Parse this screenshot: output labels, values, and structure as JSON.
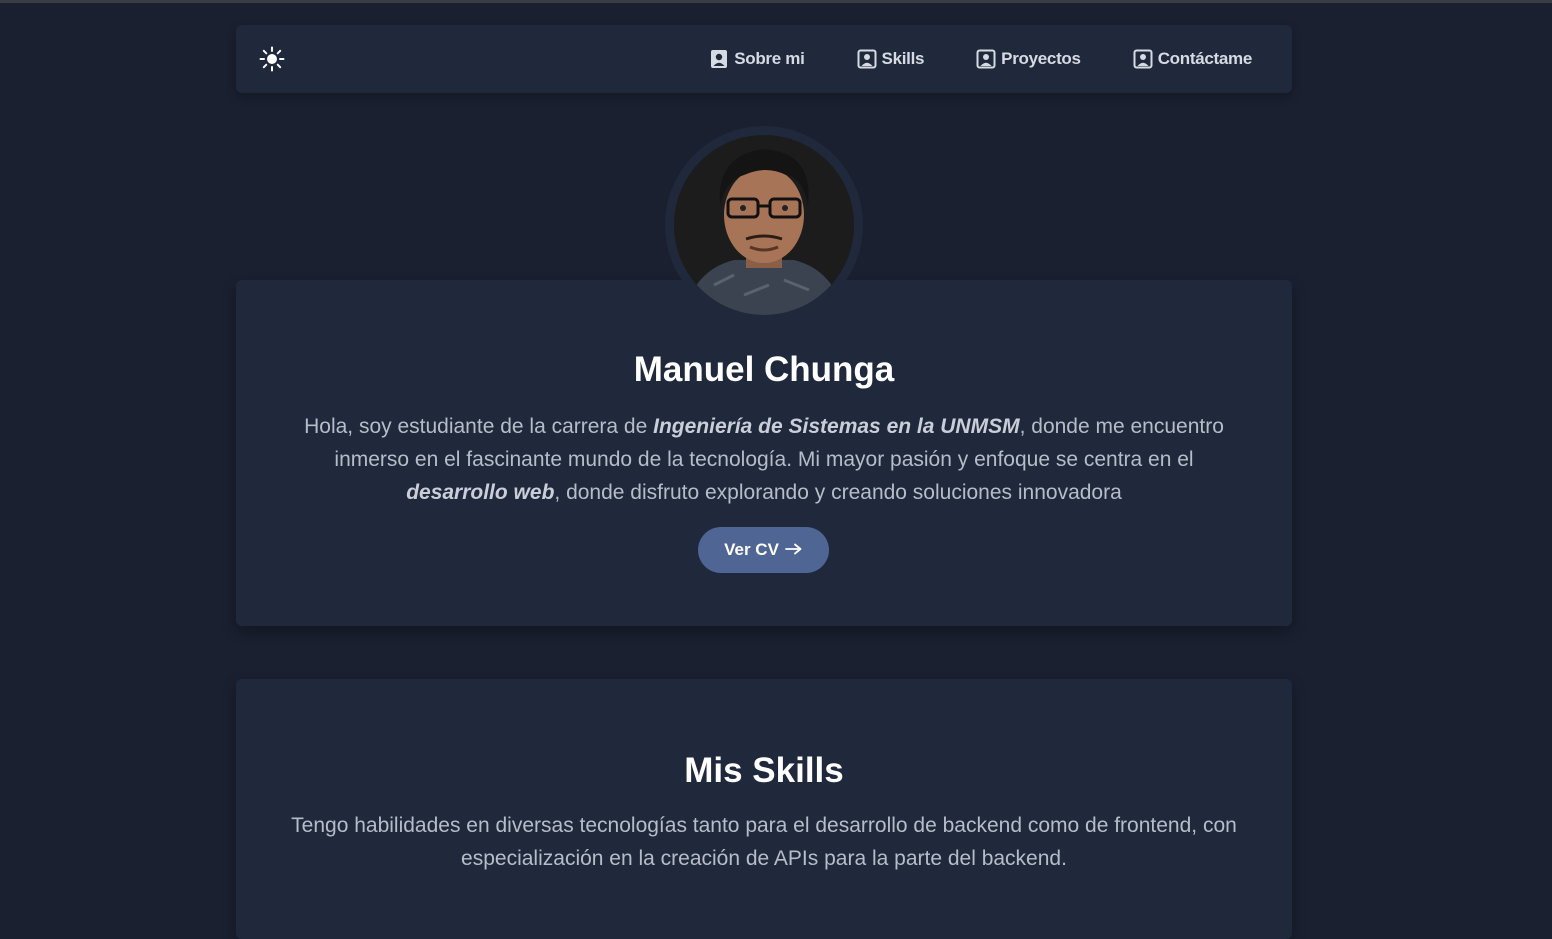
{
  "nav": {
    "theme_toggle_icon": "sun-icon",
    "links": [
      {
        "label": "Sobre mi",
        "icon": "user-badge-icon"
      },
      {
        "label": "Skills",
        "icon": "user-portrait-icon"
      },
      {
        "label": "Proyectos",
        "icon": "user-portrait-icon"
      },
      {
        "label": "Contáctame",
        "icon": "user-portrait-icon"
      }
    ]
  },
  "hero": {
    "name": "Manuel Chunga",
    "intro_1": "Hola, soy estudiante de la carrera de ",
    "intro_emph_1": "Ingeniería de Sistemas en la UNMSM",
    "intro_2": ", donde me encuentro inmerso en el fascinante mundo de la tecnología. Mi mayor pasión y enfoque se centra en el ",
    "intro_emph_2": "desarrollo web",
    "intro_3": ", donde disfruto explorando y creando soluciones innovadora",
    "cv_button_label": "Ver CV",
    "cv_button_icon": "arrow-right-icon"
  },
  "skills": {
    "title": "Mis Skills",
    "description": "Tengo habilidades en diversas tecnologías tanto para el desarrollo de backend como de frontend, con especialización en la creación de APIs para la parte del backend."
  },
  "colors": {
    "background": "#1a2030",
    "card": "#1f293b",
    "accent_button": "#4f6593",
    "text_primary": "#ffffff",
    "text_secondary": "#b6bcc8"
  }
}
